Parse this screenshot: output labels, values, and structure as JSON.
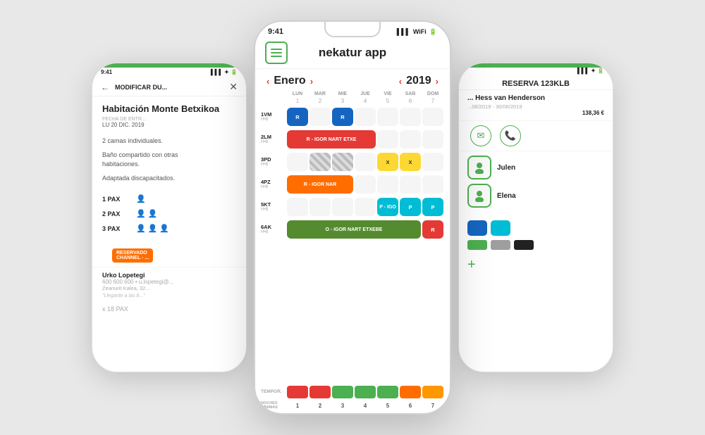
{
  "background": "#e8e8e8",
  "app": {
    "title": "nekatur app",
    "status_time": "9:41",
    "signal": "▌▌▌",
    "wifi": "WiFi",
    "battery": "🔋",
    "menu_icon": "☰"
  },
  "calendar": {
    "prev_btn": "‹",
    "next_btn": "›",
    "month": "Enero",
    "year": "2019",
    "year_prev": "‹",
    "year_next": "›",
    "days": [
      "LUN",
      "MAR",
      "MIE",
      "JUE",
      "VIE",
      "SAB",
      "DOM"
    ],
    "day_nums": [
      "1",
      "2",
      "3",
      "4",
      "5",
      "6",
      "7"
    ]
  },
  "rooms": [
    {
      "code": "1VM",
      "type": "H•B",
      "cells": [
        "blue",
        "empty",
        "blue",
        "empty",
        "empty",
        "empty",
        "empty"
      ],
      "labels": [
        "R",
        "",
        "R",
        "",
        "",
        "",
        ""
      ]
    },
    {
      "code": "2LM",
      "type": "H•B",
      "span": {
        "start": 0,
        "end": 3,
        "color": "red",
        "text": "R - IGOR NART ETXE"
      },
      "cells_after": []
    },
    {
      "code": "3PD",
      "type": "H•B",
      "cells": [
        "empty",
        "striped",
        "striped",
        "empty",
        "yellow",
        "yellow",
        "empty"
      ],
      "labels": [
        "",
        "",
        "",
        "",
        "X",
        "X",
        ""
      ]
    },
    {
      "code": "4PZ",
      "type": "H•B",
      "span_orange": {
        "start": 0,
        "end": 2,
        "text": "R - IGOR NAR"
      }
    },
    {
      "code": "5KT",
      "type": "H•B",
      "cells": [
        "empty",
        "empty",
        "empty",
        "empty",
        "cyan",
        "cyan",
        "cyan"
      ],
      "span_cyan": {
        "start": 4,
        "text": "P - IGO"
      },
      "extra_p": [
        "P",
        "P"
      ]
    },
    {
      "code": "6AK",
      "type": "H•B",
      "span_olive": {
        "start": 0,
        "end": 5,
        "text": "O - IGOR NART ETXEBE"
      },
      "end_red": "R"
    }
  ],
  "tempor": {
    "label": "TEMPOR.",
    "colors": [
      "#e53935",
      "#e53935",
      "#4CAF50",
      "#4CAF50",
      "#4CAF50",
      "#FF6D00",
      "#FF9800"
    ]
  },
  "noches": {
    "label": "NOCHES\nMÍNIMAS",
    "nums": [
      "1",
      "2",
      "3",
      "4",
      "5",
      "6",
      "7"
    ]
  },
  "left_phone": {
    "time": "9:41",
    "back_label": "←",
    "title": "MODIFICAR DU...",
    "room_name": "Habitación Monte Betxikoa",
    "date_label": "FECHA DE ENTR...",
    "date_val": "LU 20 DIC. 2019",
    "desc1": "2 camas individuales.",
    "desc2": "Baño compartido con otras\nhabitaciones.",
    "desc3": "Adaptada discapacitados.",
    "pax": [
      {
        "num": "1 PAX",
        "icons": 1
      },
      {
        "num": "2 PAX",
        "icons": 2
      },
      {
        "num": "3 PAX",
        "icons": 3
      }
    ],
    "reserved_badge": "RESERVADO\nCHANNEL - ...",
    "user_name": "Urko Lopetegi",
    "user_phone": "600 600 600 • u.lopetegi@...",
    "user_addr": "Zeanurit Kalea, 32...",
    "user_quote": "\"Llegarán a las 8...\"",
    "x18": "x 18 PAX"
  },
  "right_phone": {
    "reservation_id": "RESERVA 123KLB",
    "guest_name": "... Hess van Henderson",
    "dates": "...06/2019 - 30/06/2019",
    "price": "138,36 €",
    "action_email": "✉",
    "action_phone": "📞",
    "guest1": {
      "icon": "👤",
      "name": "Julen",
      "role": ""
    },
    "guest2": {
      "icon": "👤",
      "name": "Elena",
      "role": ""
    },
    "swatches": [
      "#1565C0",
      "#00BCD4",
      ""
    ],
    "color_chips": [
      "#4CAF50",
      "#9E9E9E",
      "#212121"
    ],
    "plus_label": "+"
  }
}
